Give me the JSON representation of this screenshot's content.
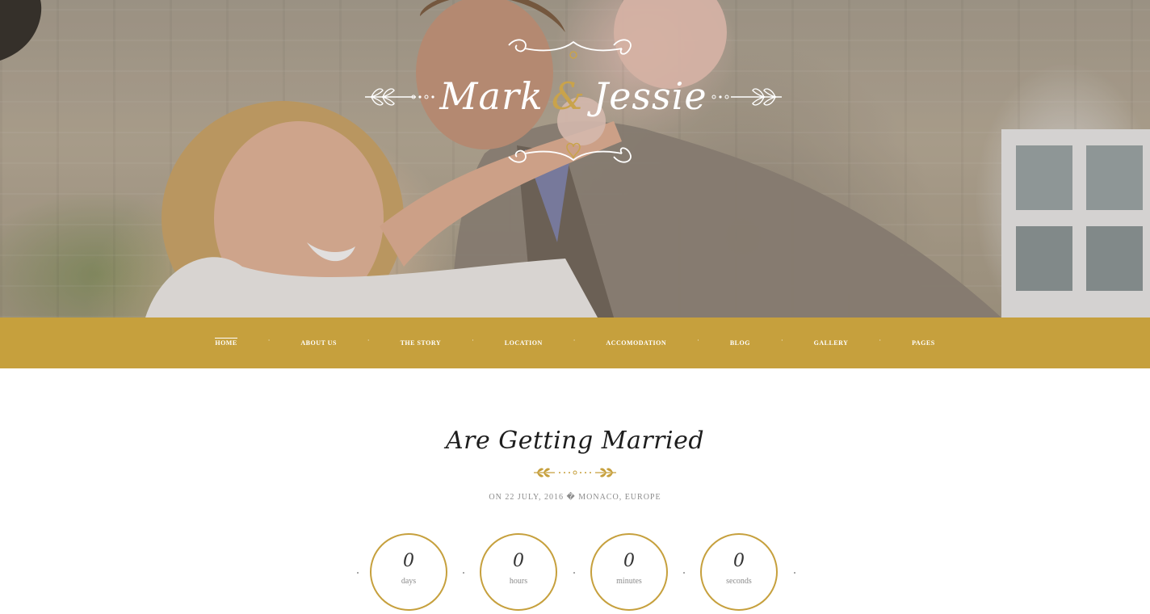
{
  "hero": {
    "name_left": "Mark",
    "ampersand": "&",
    "name_right": "Jessie"
  },
  "nav": {
    "items": [
      {
        "label": "HOME",
        "active": true
      },
      {
        "label": "ABOUT US"
      },
      {
        "label": "THE STORY"
      },
      {
        "label": "LOCATION"
      },
      {
        "label": "ACCOMODATION"
      },
      {
        "label": "BLOG"
      },
      {
        "label": "GALLERY"
      },
      {
        "label": "PAGES"
      }
    ],
    "separator": "·"
  },
  "main": {
    "headline": "Are Getting Married",
    "date_line": "ON 22 JULY, 2016 � MONACO, EUROPE"
  },
  "countdown": {
    "days_value": "0",
    "days_label": "days",
    "hours_value": "0",
    "hours_label": "hours",
    "minutes_value": "0",
    "minutes_label": "minutes",
    "seconds_value": "0",
    "seconds_label": "seconds"
  },
  "colors": {
    "accent_gold": "#c6a03d",
    "text_gray": "#8b8b8b"
  }
}
